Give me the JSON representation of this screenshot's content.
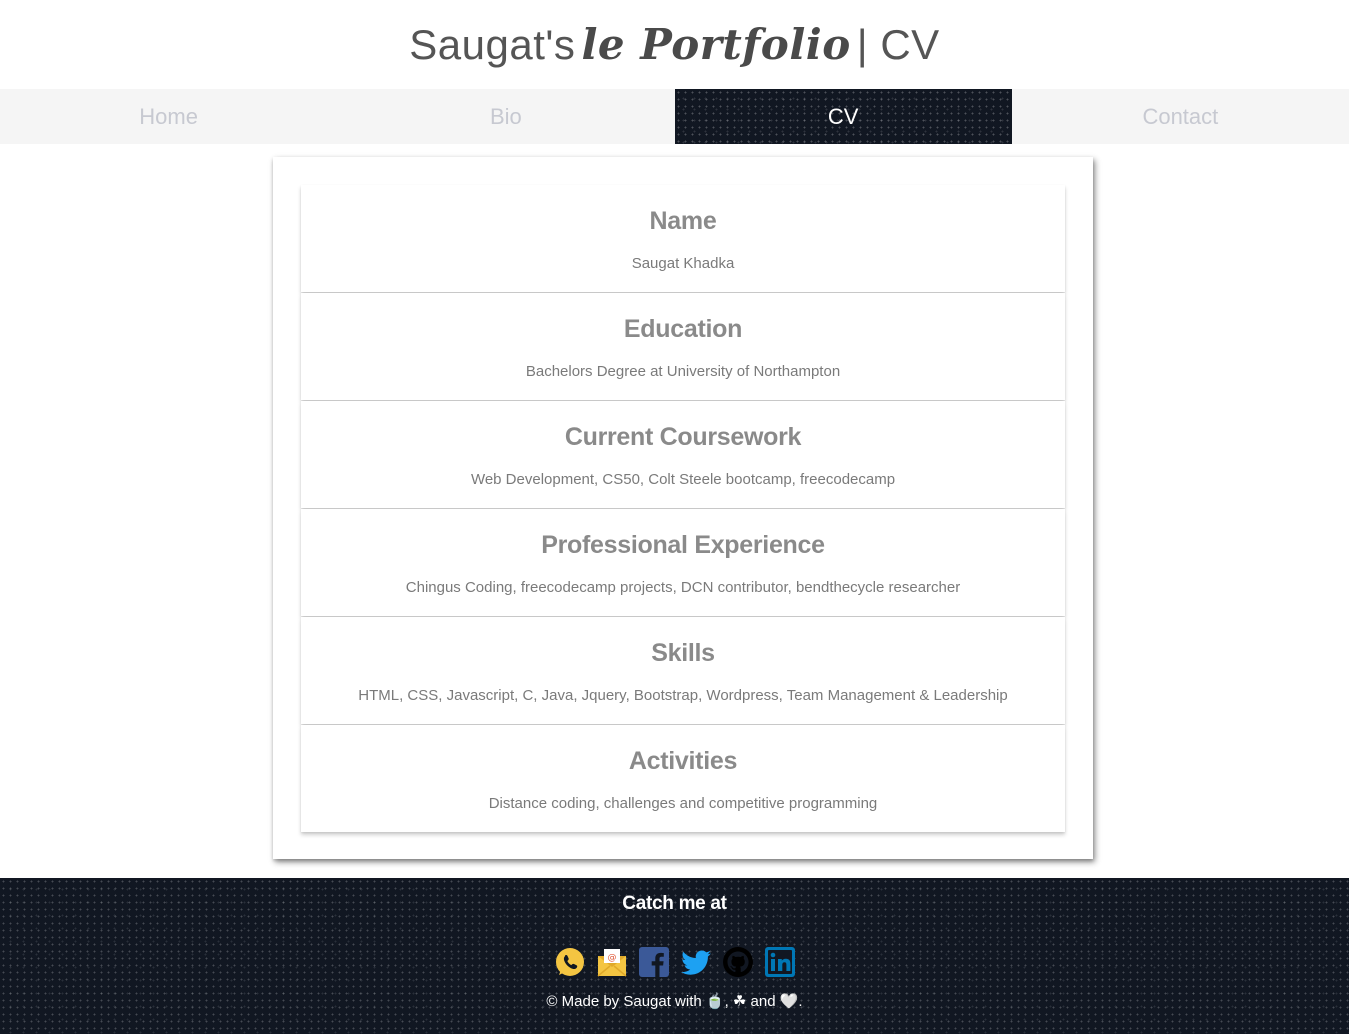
{
  "header": {
    "title_prefix": "Saugat's",
    "title_script": "le Portfolio",
    "title_suffix": "| CV"
  },
  "nav": {
    "items": [
      {
        "label": "Home"
      },
      {
        "label": "Bio"
      },
      {
        "label": "CV"
      },
      {
        "label": "Contact"
      }
    ],
    "active": "CV"
  },
  "cv": {
    "sections": [
      {
        "heading": "Name",
        "text": "Saugat Khadka"
      },
      {
        "heading": "Education",
        "text": "Bachelors Degree at University of Northampton"
      },
      {
        "heading": "Current Coursework",
        "text": "Web Development, CS50, Colt Steele bootcamp, freecodecamp"
      },
      {
        "heading": "Professional Experience",
        "text": "Chingus Coding, freecodecamp projects, DCN contributor, bendthecycle researcher"
      },
      {
        "heading": "Skills",
        "text": "HTML, CSS, Javascript, C, Java, Jquery, Bootstrap, Wordpress, Team Management & Leadership"
      },
      {
        "heading": "Activities",
        "text": "Distance coding, challenges and competitive programming"
      }
    ]
  },
  "footer": {
    "title": "Catch me at",
    "social_icons": [
      "whatsapp-icon",
      "email-icon",
      "facebook-icon",
      "twitter-icon",
      "github-icon",
      "linkedin-icon"
    ],
    "copyright": "© Made by Saugat with 🍵, ☘ and 🤍."
  },
  "colors": {
    "nav_bg": "#f5f5f5",
    "nav_inactive_text": "#c7c9d1",
    "dark_bg": "#111722",
    "heading": "#8a8a8a",
    "body_text": "#7a7a7a"
  }
}
